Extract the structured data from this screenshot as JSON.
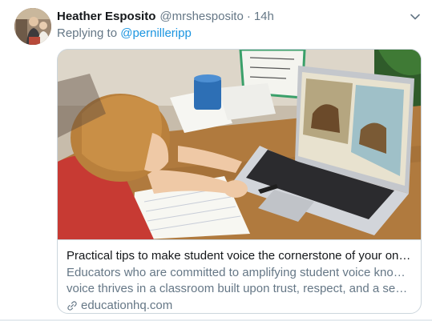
{
  "tweet": {
    "author_name": "Heather Esposito",
    "author_handle": "@mrshesposito",
    "separator": "·",
    "timestamp": "14h",
    "reply_prefix": "Replying to",
    "reply_handle": "@pernilleripp"
  },
  "card": {
    "title": "Practical tips to make student voice the cornerstone of your online cl...",
    "description_line1": "Educators who are committed to amplifying student voice know that",
    "description_line2": "voice thrives in a classroom built upon trust, respect, and a sense of ...",
    "domain": "educationhq.com"
  },
  "icons": {
    "menu": "chevron-down-icon",
    "link": "link-icon"
  },
  "colors": {
    "link_blue": "#1b95e0",
    "secondary_text": "#657786",
    "primary_text": "#14171a",
    "border": "#ccd6dd"
  }
}
